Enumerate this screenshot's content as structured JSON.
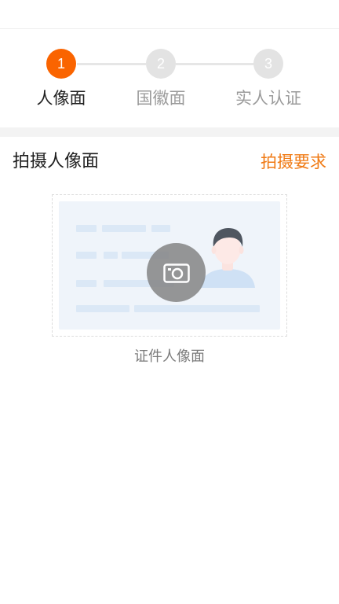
{
  "steps": [
    {
      "number": "1",
      "label": "人像面",
      "state": "active"
    },
    {
      "number": "2",
      "label": "国徽面",
      "state": "pending"
    },
    {
      "number": "3",
      "label": "实人认证",
      "state": "pending"
    }
  ],
  "section": {
    "title": "拍摄人像面",
    "requirements_link": "拍摄要求"
  },
  "capture": {
    "caption": "证件人像面",
    "icon": "camera-icon",
    "illustration": "id-card-portrait-side"
  },
  "colors": {
    "accent": "#fa6400",
    "link": "#f07a14",
    "inactive_step": "#e3e3e3",
    "card_background": "#eff4fa"
  }
}
